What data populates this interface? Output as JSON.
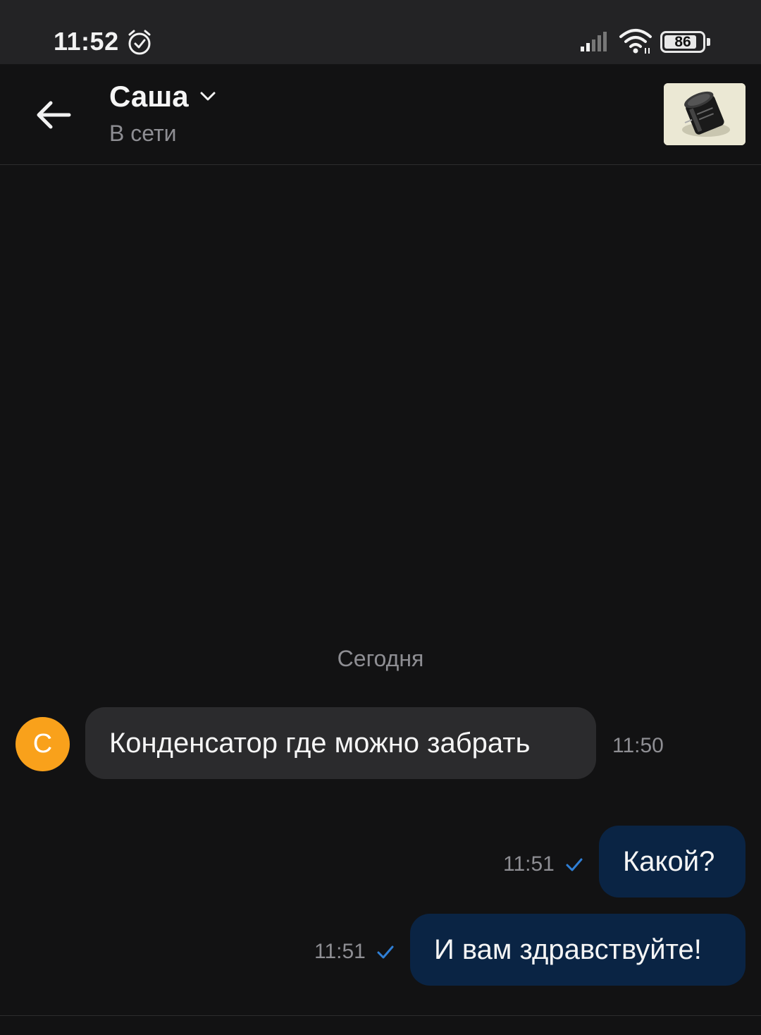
{
  "status_bar": {
    "time": "11:52",
    "battery_level": "86",
    "battery_percent": 86
  },
  "header": {
    "contact_name": "Саша",
    "contact_status": "В сети"
  },
  "chat": {
    "date_divider": "Сегодня",
    "avatar_initial": "С",
    "avatar_color": "#f9a11b",
    "messages": [
      {
        "direction": "incoming",
        "text": "Конденсатор где можно забрать",
        "time": "11:50"
      },
      {
        "direction": "outgoing",
        "text": "Какой?",
        "time": "11:51"
      },
      {
        "direction": "outgoing",
        "text": "И вам здравствуйте!",
        "time": "11:51"
      }
    ]
  },
  "colors": {
    "background": "#121213",
    "incoming_bubble": "#2b2b2d",
    "outgoing_bubble": "#0a2444",
    "read_check": "#2f7fd6"
  }
}
